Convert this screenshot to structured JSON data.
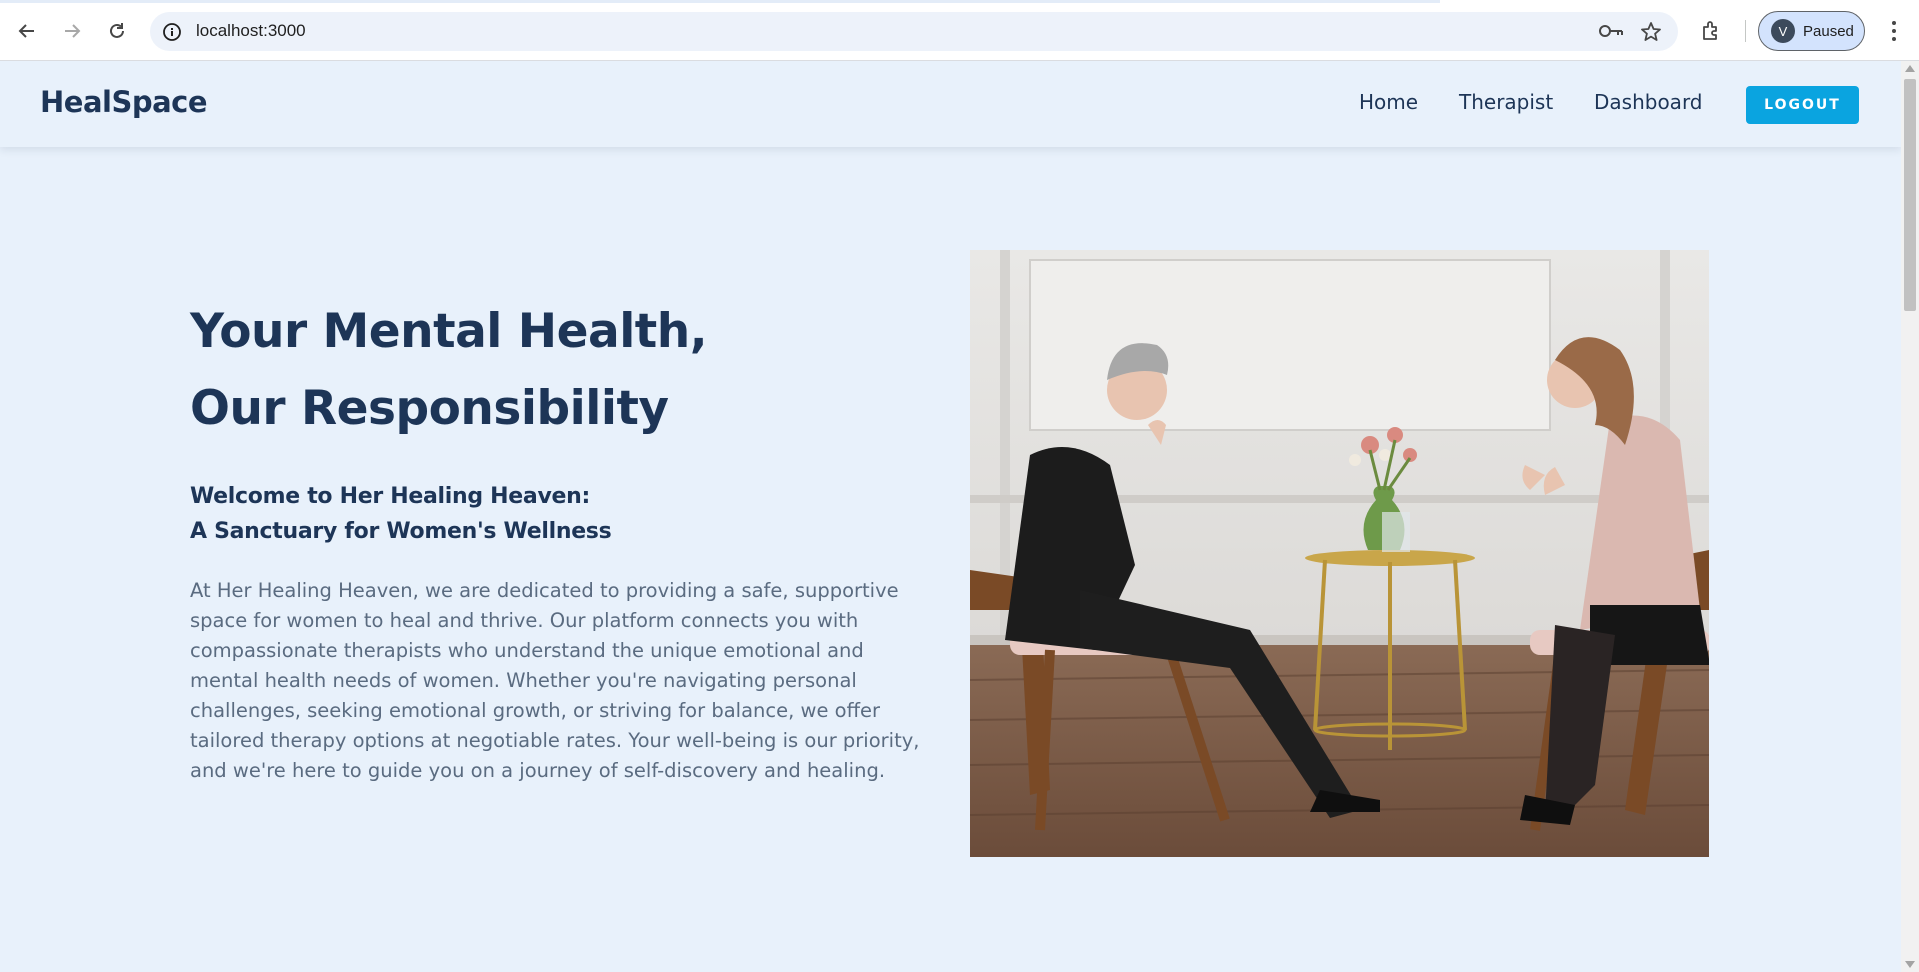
{
  "browser": {
    "url": "localhost:3000",
    "profile_initial": "V",
    "profile_status": "Paused"
  },
  "navbar": {
    "brand": "HealSpace",
    "links": [
      "Home",
      "Therapist",
      "Dashboard"
    ],
    "logout_label": "LOGOUT",
    "accent_color": "#0aa4e0"
  },
  "hero": {
    "title_line1": "Your Mental Health,",
    "title_line2": "Our Responsibility",
    "subtitle_line1": "Welcome to Her Healing Heaven:",
    "subtitle_line2": "A Sanctuary for Women's Wellness",
    "body": "At Her Healing Heaven, we are dedicated to providing a safe, supportive space for women to heal and thrive. Our platform connects you with compassionate therapists who understand the unique emotional and mental health needs of women. Whether you're navigating personal challenges, seeking emotional growth, or striving for balance, we offer tailored therapy options at negotiable rates. Your well-being is our priority, and we're here to guide you on a journey of self-discovery and healing."
  },
  "colors": {
    "page_background": "#e8f1fb",
    "heading": "#1d3557",
    "body_text": "#5a6b80"
  }
}
